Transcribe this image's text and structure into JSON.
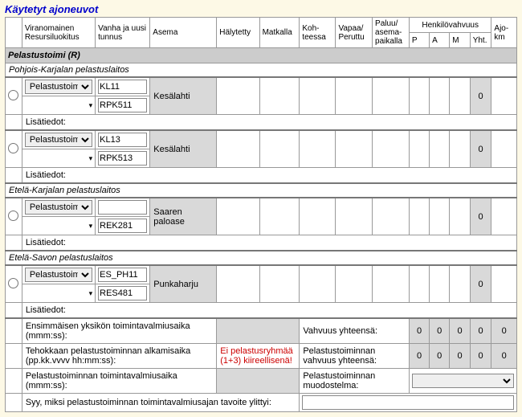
{
  "title": "Käytetyt ajoneuvot",
  "headers": {
    "col1": "Viranomainen Resursiluokitus",
    "col2": "Vanha ja uusi tunnus",
    "col3": "Asema",
    "col4": "Hälytetty",
    "col5": "Matkalla",
    "col6": "Koh-teessa",
    "col7": "Vapaa/\nPeruttu",
    "col8": "Paluu/\nasema-\npaikalla",
    "hv": "Henkilövahvuus",
    "p": "P",
    "a": "A",
    "m": "M",
    "yht": "Yht.",
    "ajo": "Ajo-km"
  },
  "group": "Pelastustoimi (R)",
  "dept1": "Pohjois-Karjalan pelastuslaitos",
  "dept2": "Etelä-Karjalan pelastuslaitos",
  "dept3": "Etelä-Savon pelastuslaitos",
  "lisatiedot": "Lisätiedot:",
  "sel": "Pelastustoimi (",
  "r1": {
    "id1": "KL11",
    "id2": "RPK511",
    "asema": "Kesälahti",
    "yht": "0"
  },
  "r2": {
    "id1": "KL13",
    "id2": "RPK513",
    "asema": "Kesälahti",
    "yht": "0"
  },
  "r3": {
    "id1": "",
    "id2": "REK281",
    "asema": "Saaren paloase",
    "yht": "0"
  },
  "r4": {
    "id1": "ES_PH11",
    "id2": "RES481",
    "asema": "Punkaharju",
    "yht": "0"
  },
  "footer": {
    "l1": "Ensimmäisen yksikön toimintavalmiusaika (mmm:ss):",
    "l2": "Tehokkaan pelastustoiminnan alkamisaika (pp.kk.vvvv hh:mm:ss):",
    "l2note": "Ei pelastusryhmää (1+3) kiireellisenä!",
    "l3": "Pelastustoiminnan toimintavalmiusaika (mmm:ss):",
    "l4": "Syy, miksi pelastustoiminnan toimintavalmiusajan tavoite ylittyi:",
    "r1": "Vahvuus yhteensä:",
    "r2": "Pelastustoiminnan vahvuus yhteensä:",
    "r3": "Pelastustoiminnan muodostelma:",
    "zero": "0"
  }
}
